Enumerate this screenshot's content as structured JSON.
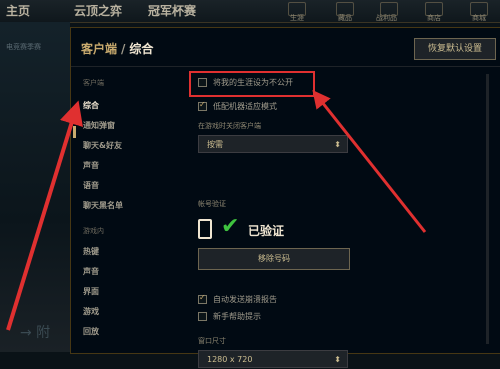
{
  "topnav": {
    "items": [
      "主页",
      "云顶之弈",
      "冠军杯赛"
    ],
    "icon_labels": [
      "生涯",
      "藏品",
      "战利品",
      "商店",
      "商城"
    ]
  },
  "background": {
    "left_hint": "电竞赛季赛",
    "ghost_text": "→ 附"
  },
  "modal": {
    "breadcrumb_parent": "客户端",
    "breadcrumb_sep": "/",
    "breadcrumb_current": "综合",
    "restore_button": "恢复默认设置"
  },
  "sidebar": {
    "section_client": "客户端",
    "client_items": [
      "综合",
      "通知弹窗",
      "聊天&好友",
      "声音",
      "语音",
      "聊天黑名单"
    ],
    "active_index": 0,
    "section_ingame": "游戏内",
    "ingame_items": [
      "热键",
      "声音",
      "界面",
      "游戏",
      "回放"
    ]
  },
  "content": {
    "hide_career": {
      "label": "将我的生涯设为不公开",
      "checked": false
    },
    "low_spec": {
      "label": "低配机器适应模式",
      "checked": true
    },
    "close_client_label": "在游戏时关闭客户端",
    "close_client_value": "按需",
    "account_verify_label": "帐号验证",
    "verified_text": "已验证",
    "remove_number_button": "移除号码",
    "auto_accept_report": {
      "label": "自动发送崩溃报告",
      "checked": true
    },
    "newbie_tips": {
      "label": "新手帮助提示",
      "checked": false
    },
    "window_size_label": "窗口尺寸",
    "window_size_value": "1280 x 720"
  },
  "annotation_color": "#e03030"
}
